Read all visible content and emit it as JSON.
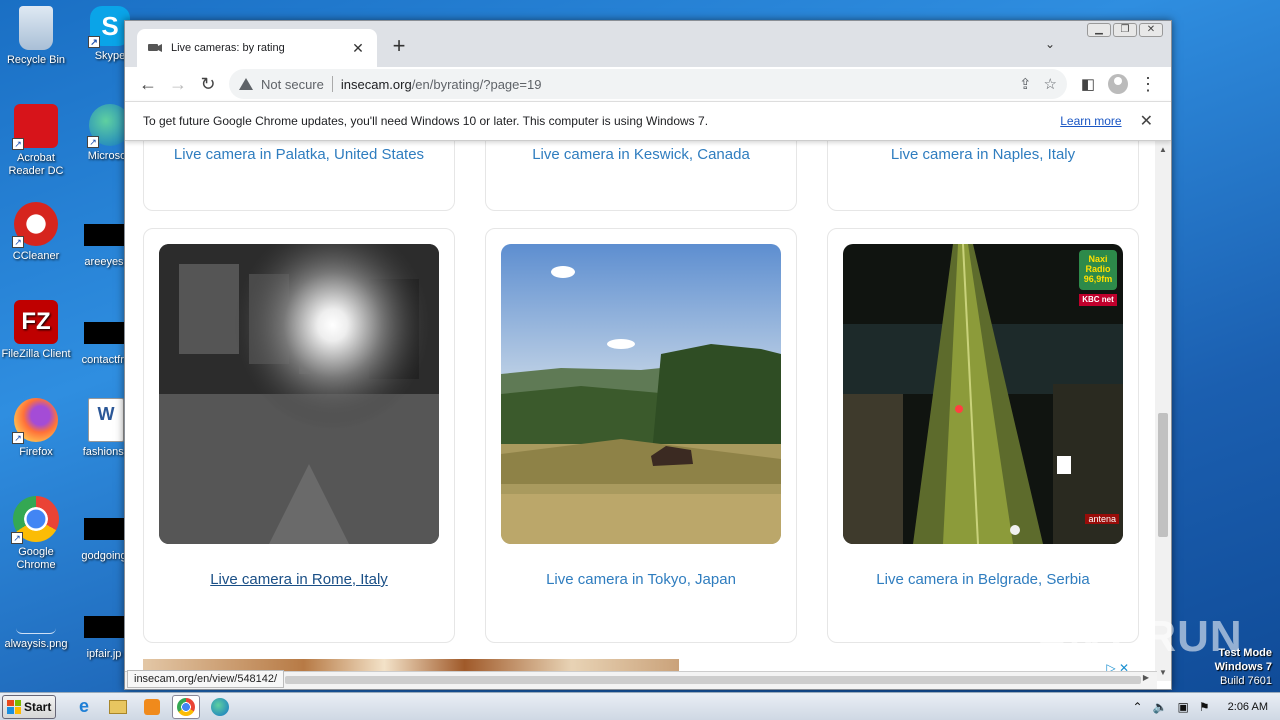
{
  "desktop": {
    "icons": [
      {
        "label": "Recycle Bin"
      },
      {
        "label": "Skype"
      },
      {
        "label": "Acrobat Reader DC"
      },
      {
        "label": "Microsoft"
      },
      {
        "label": "CCleaner"
      },
      {
        "label": "areeyes"
      },
      {
        "label": "FileZilla Client"
      },
      {
        "label": "contactfri"
      },
      {
        "label": "Firefox"
      },
      {
        "label": "fashionsy"
      },
      {
        "label": "Google Chrome"
      },
      {
        "label": "godgoing"
      },
      {
        "label": "alwaysis.png"
      },
      {
        "label": "ipfair.jp"
      }
    ]
  },
  "browser": {
    "tab": {
      "title": "Live cameras: by rating",
      "favicon": "camera-icon"
    },
    "omnibox": {
      "security": "Not secure",
      "host": "insecam.org",
      "path": "/en/byrating/?page=19"
    },
    "infobar": {
      "message": "To get future Google Chrome updates, you'll need Windows 10 or later. This computer is using Windows 7.",
      "link": "Learn more"
    },
    "status_url": "insecam.org/en/view/548142/"
  },
  "page": {
    "top_row": [
      {
        "caption": "Live camera in Palatka, United States"
      },
      {
        "caption": "Live camera in Keswick, Canada"
      },
      {
        "caption": "Live camera in Naples, Italy"
      }
    ],
    "main_row": [
      {
        "caption": "Live camera in Rome, Italy",
        "scene": "night-gray-interior",
        "hovered": true
      },
      {
        "caption": "Live camera in Tokyo, Japan",
        "scene": "countryside-field"
      },
      {
        "caption": "Live camera in Belgrade, Serbia",
        "scene": "night-highway",
        "overlay_logo": "Naxi Radio 96,9fm",
        "overlay_logo2": "KBC net",
        "watermark": "antena"
      }
    ]
  },
  "taskbar": {
    "start_label": "Start",
    "clock": "2:06 AM",
    "watermark": {
      "line1": "Test Mode",
      "line2": "Windows 7",
      "line3": "Build 7601"
    },
    "anyrun": "ANY RUN"
  }
}
